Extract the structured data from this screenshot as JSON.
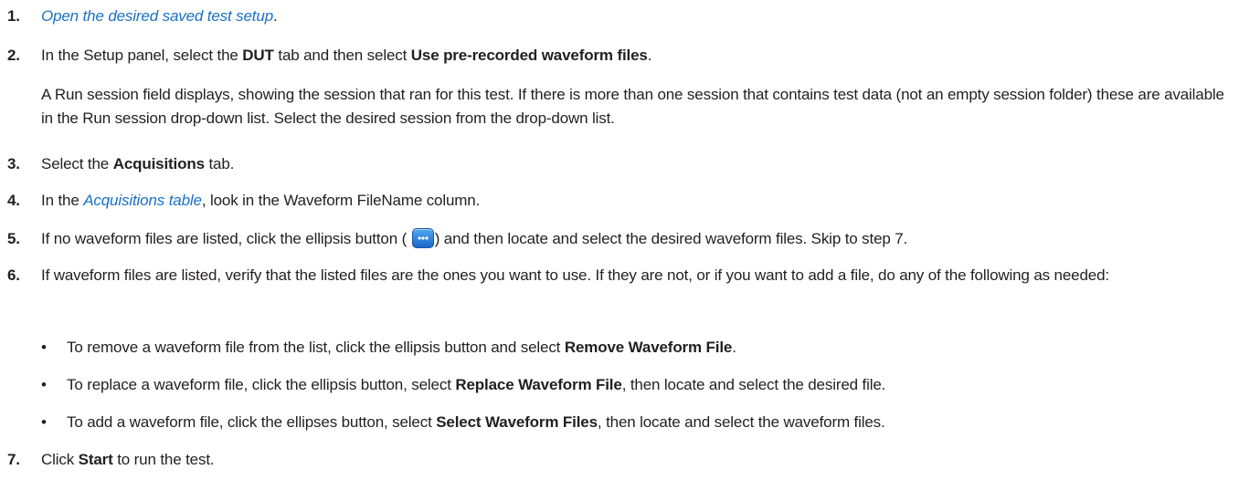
{
  "steps": [
    {
      "num": "1.",
      "link": "Open the desired saved test setup",
      "after": "."
    },
    {
      "num": "2.",
      "t1": "In the Setup panel, select the ",
      "b1": "DUT",
      "t2": " tab and then select ",
      "b2": "Use pre-recorded waveform files",
      "t3": ".",
      "para": "A Run session field displays, showing the session that ran for this test. If there is more than one session that contains test data (not an empty session folder) these are available in the Run session drop-down list. Select the desired session from the drop-down list."
    },
    {
      "num": "3.",
      "t1": "Select the ",
      "b1": "Acquisitions",
      "t2": " tab."
    },
    {
      "num": "4.",
      "t1": "In the ",
      "link": "Acquisitions table",
      "t2": ", look in the Waveform FileName column."
    },
    {
      "num": "5.",
      "t1": "If no waveform files are listed, click the ellipsis button ( ",
      "t2": ") and then locate and select the desired waveform files. Skip to step 7."
    },
    {
      "num": "6.",
      "text": "If waveform files are listed, verify that the listed files are the ones you want to use. If they are not, or if you want to add a file, do any of the following as needed:",
      "bullets": [
        {
          "dot": "•",
          "t1": "To remove a waveform file from the list, click the ellipsis button and select ",
          "b1": "Remove Waveform File",
          "t2": "."
        },
        {
          "dot": "•",
          "t1": "To replace a waveform file, click the ellipsis button, select ",
          "b1": "Replace Waveform File",
          "t2": ", then locate and select the desired file."
        },
        {
          "dot": "•",
          "t1": "To add a waveform file, click the ellipses button, select ",
          "b1": "Select Waveform Files",
          "t2": ", then locate and select the waveform files."
        }
      ]
    },
    {
      "num": "7.",
      "t1": "Click ",
      "b1": "Start",
      "t2": " to run the test."
    }
  ],
  "colors": {
    "text": "#231f20",
    "link": "#1a6fc4",
    "button": "#2f86e0"
  },
  "icons": {
    "ellipsis": "ellipsis-button-icon"
  }
}
